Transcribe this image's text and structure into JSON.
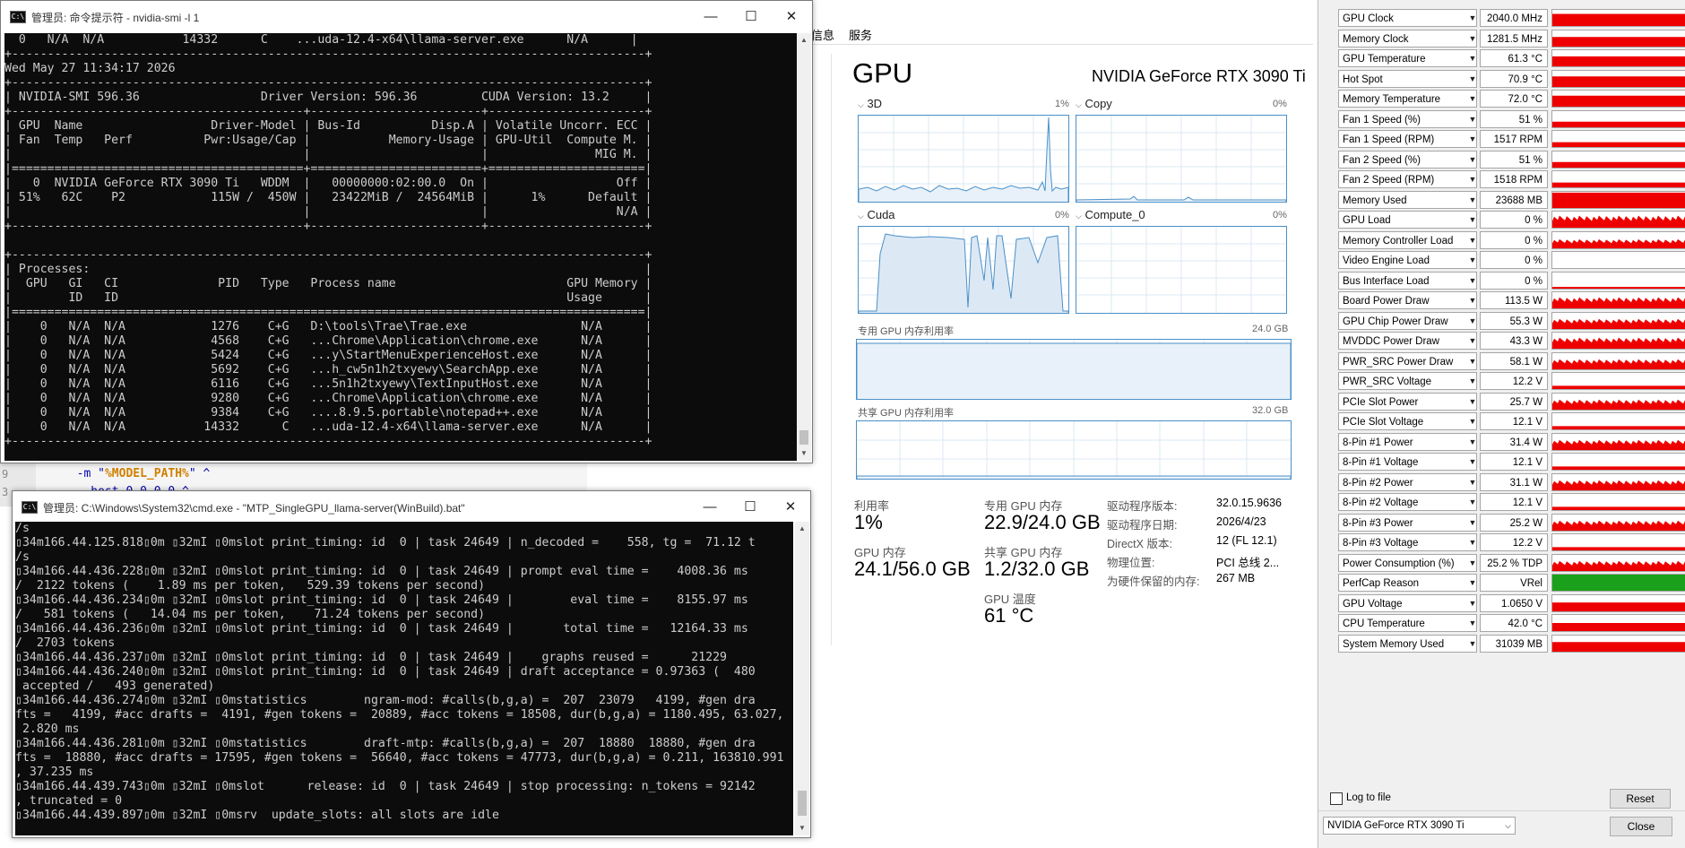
{
  "editor": {
    "lines": [
      {
        "num": "9",
        "pre": "  -m \"",
        "var": "%MODEL_PATH%",
        "post": "\" ^"
      },
      {
        "num": "3",
        "pre": "  --host 0.0.0.0 ^",
        "var": "",
        "post": ""
      }
    ]
  },
  "smi_window": {
    "title": "管理员: 命令提示符 - nvidia-smi  -l 1",
    "controls": {
      "minimize": "—",
      "maximize": "☐",
      "close": "✕"
    },
    "console": [
      "  0   N/A  N/A           14332      C    ...uda-12.4-x64\\llama-server.exe      N/A      |",
      "+-----------------------------------------------------------------------------------------+",
      "Wed May 27 11:34:17 2026",
      "+-----------------------------------------------------------------------------------------+",
      "| NVIDIA-SMI 596.36                 Driver Version: 596.36         CUDA Version: 13.2     |",
      "+-----------------------------------------+------------------------+----------------------+",
      "| GPU  Name                  Driver-Model | Bus-Id          Disp.A | Volatile Uncorr. ECC |",
      "| Fan  Temp   Perf          Pwr:Usage/Cap |           Memory-Usage | GPU-Util  Compute M. |",
      "|                                         |                        |               MIG M. |",
      "|=========================================+========================+======================|",
      "|   0  NVIDIA GeForce RTX 3090 Ti   WDDM  |   00000000:02:00.0  On |                  Off |",
      "| 51%   62C    P2            115W /  450W |   23422MiB /  24564MiB |      1%      Default |",
      "|                                         |                        |                  N/A |",
      "+-----------------------------------------+------------------------+----------------------+",
      "",
      "+-----------------------------------------------------------------------------------------+",
      "| Processes:                                                                              |",
      "|  GPU   GI   CI              PID   Type   Process name                        GPU Memory |",
      "|        ID   ID                                                               Usage      |",
      "|=========================================================================================|",
      "|    0   N/A  N/A            1276    C+G   D:\\tools\\Trae\\Trae.exe                N/A      |",
      "|    0   N/A  N/A            4568    C+G   ...Chrome\\Application\\chrome.exe      N/A      |",
      "|    0   N/A  N/A            5424    C+G   ...y\\StartMenuExperienceHost.exe      N/A      |",
      "|    0   N/A  N/A            5692    C+G   ...h_cw5n1h2txyewy\\SearchApp.exe      N/A      |",
      "|    0   N/A  N/A            6116    C+G   ...5n1h2txyewy\\TextInputHost.exe      N/A      |",
      "|    0   N/A  N/A            9280    C+G   ...Chrome\\Application\\chrome.exe      N/A      |",
      "|    0   N/A  N/A            9384    C+G   ....8.9.5.portable\\notepad++.exe      N/A      |",
      "|    0   N/A  N/A           14332      C   ...uda-12.4-x64\\llama-server.exe      N/A      |",
      "+-----------------------------------------------------------------------------------------+"
    ]
  },
  "llama_window": {
    "title": "管理员: C:\\Windows\\System32\\cmd.exe - \"MTP_SingleGPU_llama-server(WinBuild).bat\"",
    "controls": {
      "minimize": "—",
      "maximize": "☐",
      "close": "✕"
    },
    "console": [
      "/s",
      "▯34m166.44.125.818▯0m ▯32mI ▯0mslot print_timing: id  0 | task 24649 | n_decoded =    558, tg =  71.12 t",
      "/s",
      "▯34m166.44.436.228▯0m ▯32mI ▯0mslot print_timing: id  0 | task 24649 | prompt eval time =    4008.36 ms",
      "/  2122 tokens (    1.89 ms per token,   529.39 tokens per second)",
      "▯34m166.44.436.234▯0m ▯32mI ▯0mslot print_timing: id  0 | task 24649 |        eval time =    8155.97 ms",
      "/   581 tokens (   14.04 ms per token,    71.24 tokens per second)",
      "▯34m166.44.436.236▯0m ▯32mI ▯0mslot print_timing: id  0 | task 24649 |       total time =   12164.33 ms",
      "/  2703 tokens",
      "▯34m166.44.436.237▯0m ▯32mI ▯0mslot print_timing: id  0 | task 24649 |    graphs reused =      21229",
      "▯34m166.44.436.240▯0m ▯32mI ▯0mslot print_timing: id  0 | task 24649 | draft acceptance = 0.97363 (  480",
      " accepted /   493 generated)",
      "▯34m166.44.436.274▯0m ▯32mI ▯0mstatistics        ngram-mod: #calls(b,g,a) =  207  23079   4199, #gen dra",
      "fts =   4199, #acc drafts =  4191, #gen tokens =  20889, #acc tokens = 18508, dur(b,g,a) = 1180.495, 63.027,",
      " 2.820 ms",
      "▯34m166.44.436.281▯0m ▯32mI ▯0mstatistics        draft-mtp: #calls(b,g,a) =  207  18880  18880, #gen dra",
      "fts =  18880, #acc drafts = 17595, #gen tokens =  56640, #acc tokens = 47773, dur(b,g,a) = 0.211, 163810.991",
      ", 37.235 ms",
      "▯34m166.44.439.743▯0m ▯32mI ▯0mslot      release: id  0 | task 24649 | stop processing: n_tokens = 92142",
      ", truncated = 0",
      "▯34m166.44.439.897▯0m ▯32mI ▯0msrv  update_slots: all slots are idle"
    ]
  },
  "task_manager": {
    "tabs": [
      "信息",
      "服务"
    ],
    "heading": "GPU",
    "gpu_name": "NVIDIA GeForce RTX 3090 Ti",
    "engines": [
      {
        "label": "3D",
        "pct": "1%"
      },
      {
        "label": "Copy",
        "pct": "0%"
      },
      {
        "label": "Cuda",
        "pct": "0%"
      },
      {
        "label": "Compute_0",
        "pct": "0%"
      }
    ],
    "dedicated_label": "专用 GPU 内存利用率",
    "dedicated_max": "24.0 GB",
    "shared_label": "共享 GPU 内存利用率",
    "shared_max": "32.0 GB",
    "stats": {
      "util_label": "利用率",
      "util_value": "1%",
      "ded_label": "专用 GPU 内存",
      "ded_value": "22.9/24.0 GB",
      "gpumem_label": "GPU 内存",
      "gpumem_value": "24.1/56.0 GB",
      "shared_label": "共享 GPU 内存",
      "shared_value": "1.2/32.0 GB",
      "temp_label": "GPU 温度",
      "temp_value": "61 °C"
    },
    "details": [
      {
        "k": "驱动程序版本:",
        "v": "32.0.15.9636"
      },
      {
        "k": "驱动程序日期:",
        "v": "2026/4/23"
      },
      {
        "k": "DirectX 版本:",
        "v": "12 (FL 12.1)"
      },
      {
        "k": "物理位置:",
        "v": "PCI 总线 2..."
      },
      {
        "k": "为硬件保留的内存:",
        "v": "267 MB"
      }
    ]
  },
  "gpuz": {
    "sensors": [
      {
        "name": "GPU Clock",
        "value": "2040.0 MHz",
        "level": 0.75,
        "style": "solid"
      },
      {
        "name": "Memory Clock",
        "value": "1281.5 MHz",
        "level": 0.6,
        "style": "solid"
      },
      {
        "name": "GPU Temperature",
        "value": "61.3 °C",
        "level": 0.62,
        "style": "solid"
      },
      {
        "name": "Hot Spot",
        "value": "70.9 °C",
        "level": 0.65,
        "style": "solid"
      },
      {
        "name": "Memory Temperature",
        "value": "72.0 °C",
        "level": 0.68,
        "style": "solid"
      },
      {
        "name": "Fan 1 Speed (%)",
        "value": "51 %",
        "level": 0.35,
        "style": "flat"
      },
      {
        "name": "Fan 1 Speed (RPM)",
        "value": "1517 RPM",
        "level": 0.3,
        "style": "flat"
      },
      {
        "name": "Fan 2 Speed (%)",
        "value": "51 %",
        "level": 0.35,
        "style": "flat"
      },
      {
        "name": "Fan 2 Speed (RPM)",
        "value": "1518 RPM",
        "level": 0.3,
        "style": "flat"
      },
      {
        "name": "Memory Used",
        "value": "23688 MB",
        "level": 0.95,
        "style": "solid"
      },
      {
        "name": "GPU Load",
        "value": "0 %",
        "level": 0.6,
        "style": "spiky"
      },
      {
        "name": "Memory Controller Load",
        "value": "0 %",
        "level": 0.45,
        "style": "spiky"
      },
      {
        "name": "Video Engine Load",
        "value": "0 %",
        "level": 0.0,
        "style": "empty"
      },
      {
        "name": "Bus Interface Load",
        "value": "0 %",
        "level": 0.1,
        "style": "sparse"
      },
      {
        "name": "Board Power Draw",
        "value": "113.5 W",
        "level": 0.55,
        "style": "spiky"
      },
      {
        "name": "GPU Chip Power Draw",
        "value": "55.3 W",
        "level": 0.5,
        "style": "spiky"
      },
      {
        "name": "MVDDC Power Draw",
        "value": "43.3 W",
        "level": 0.55,
        "style": "spiky"
      },
      {
        "name": "PWR_SRC Power Draw",
        "value": "58.1 W",
        "level": 0.5,
        "style": "spiky"
      },
      {
        "name": "PWR_SRC Voltage",
        "value": "12.2 V",
        "level": 0.2,
        "style": "flat"
      },
      {
        "name": "PCIe Slot Power",
        "value": "25.7 W",
        "level": 0.5,
        "style": "spiky"
      },
      {
        "name": "PCIe Slot Voltage",
        "value": "12.1 V",
        "level": 0.2,
        "style": "flat"
      },
      {
        "name": "8-Pin #1 Power",
        "value": "31.4 W",
        "level": 0.5,
        "style": "spiky"
      },
      {
        "name": "8-Pin #1 Voltage",
        "value": "12.1 V",
        "level": 0.2,
        "style": "flat"
      },
      {
        "name": "8-Pin #2 Power",
        "value": "31.1 W",
        "level": 0.5,
        "style": "spiky"
      },
      {
        "name": "8-Pin #2 Voltage",
        "value": "12.1 V",
        "level": 0.2,
        "style": "flat"
      },
      {
        "name": "8-Pin #3 Power",
        "value": "25.2 W",
        "level": 0.5,
        "style": "spiky"
      },
      {
        "name": "8-Pin #3 Voltage",
        "value": "12.2 V",
        "level": 0.2,
        "style": "flat"
      },
      {
        "name": "Power Consumption (%)",
        "value": "25.2 % TDP",
        "level": 0.5,
        "style": "spiky"
      },
      {
        "name": "PerfCap Reason",
        "value": "VRel",
        "level": 1.0,
        "style": "green"
      },
      {
        "name": "GPU Voltage",
        "value": "1.0650 V",
        "level": 0.55,
        "style": "solid"
      },
      {
        "name": "CPU Temperature",
        "value": "42.0 °C",
        "level": 0.5,
        "style": "solid"
      },
      {
        "name": "System Memory Used",
        "value": "31039 MB",
        "level": 0.6,
        "style": "solid"
      }
    ],
    "log_label": "Log to file",
    "reset_label": "Reset",
    "device_select": "NVIDIA GeForce RTX 3090 Ti",
    "close_label": "Close",
    "colors": {
      "graph": "#ee0000",
      "perfcap": "#1aa01a"
    }
  }
}
